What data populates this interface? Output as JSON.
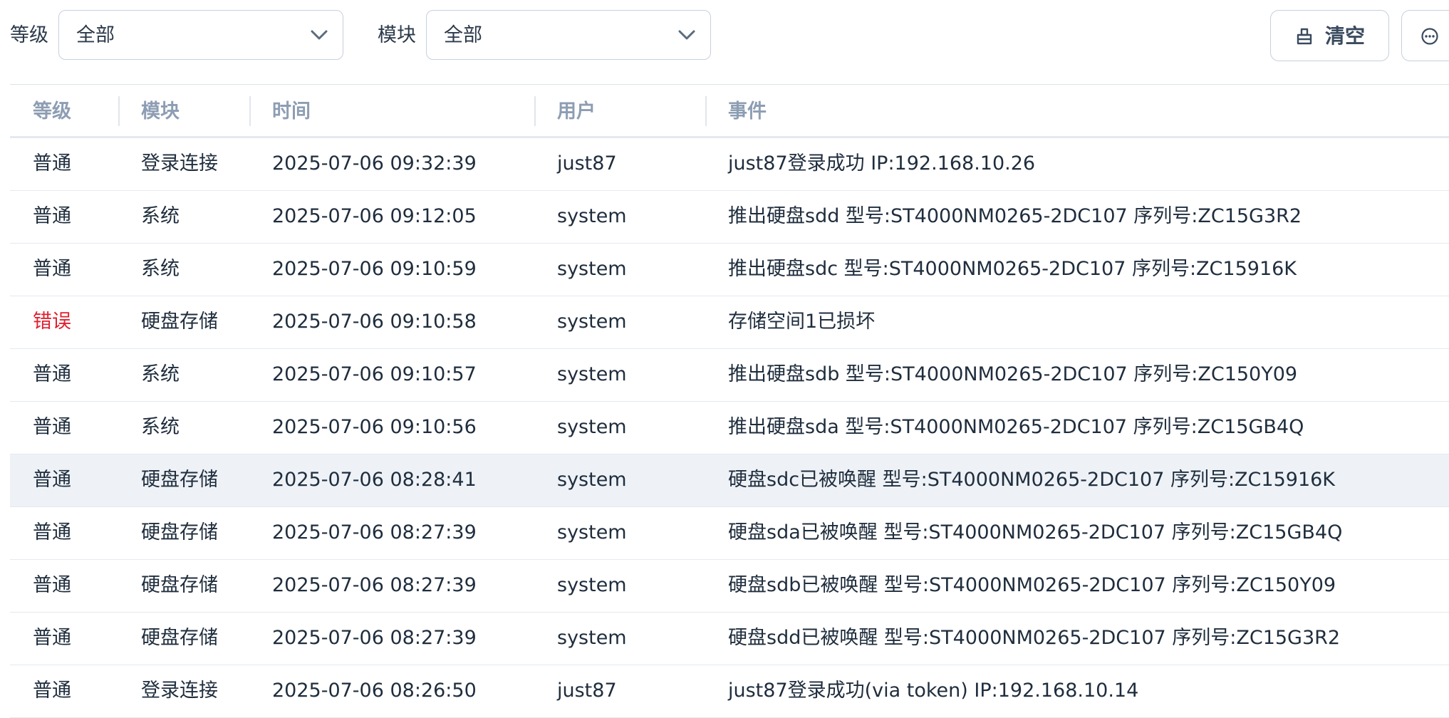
{
  "filters": {
    "level_label": "等级",
    "level_value": "全部",
    "module_label": "模块",
    "module_value": "全部"
  },
  "actions": {
    "clear_label": "清空"
  },
  "table": {
    "headers": [
      "等级",
      "模块",
      "时间",
      "用户",
      "事件"
    ],
    "rows": [
      {
        "level": "普通",
        "module": "登录连接",
        "time": "2025-07-06 09:32:39",
        "user": "just87",
        "event": "just87登录成功 IP:192.168.10.26"
      },
      {
        "level": "普通",
        "module": "系统",
        "time": "2025-07-06 09:12:05",
        "user": "system",
        "event": "推出硬盘sdd 型号:ST4000NM0265-2DC107 序列号:ZC15G3R2"
      },
      {
        "level": "普通",
        "module": "系统",
        "time": "2025-07-06 09:10:59",
        "user": "system",
        "event": "推出硬盘sdc 型号:ST4000NM0265-2DC107 序列号:ZC15916K"
      },
      {
        "level": "错误",
        "module": "硬盘存储",
        "time": "2025-07-06 09:10:58",
        "user": "system",
        "event": "存储空间1已损坏"
      },
      {
        "level": "普通",
        "module": "系统",
        "time": "2025-07-06 09:10:57",
        "user": "system",
        "event": "推出硬盘sdb 型号:ST4000NM0265-2DC107 序列号:ZC150Y09"
      },
      {
        "level": "普通",
        "module": "系统",
        "time": "2025-07-06 09:10:56",
        "user": "system",
        "event": "推出硬盘sda 型号:ST4000NM0265-2DC107 序列号:ZC15GB4Q"
      },
      {
        "level": "普通",
        "module": "硬盘存储",
        "time": "2025-07-06 08:28:41",
        "user": "system",
        "event": "硬盘sdc已被唤醒 型号:ST4000NM0265-2DC107 序列号:ZC15916K"
      },
      {
        "level": "普通",
        "module": "硬盘存储",
        "time": "2025-07-06 08:27:39",
        "user": "system",
        "event": "硬盘sda已被唤醒 型号:ST4000NM0265-2DC107 序列号:ZC15GB4Q"
      },
      {
        "level": "普通",
        "module": "硬盘存储",
        "time": "2025-07-06 08:27:39",
        "user": "system",
        "event": "硬盘sdb已被唤醒 型号:ST4000NM0265-2DC107 序列号:ZC150Y09"
      },
      {
        "level": "普通",
        "module": "硬盘存储",
        "time": "2025-07-06 08:27:39",
        "user": "system",
        "event": "硬盘sdd已被唤醒 型号:ST4000NM0265-2DC107 序列号:ZC15G3R2"
      },
      {
        "level": "普通",
        "module": "登录连接",
        "time": "2025-07-06 08:26:50",
        "user": "just87",
        "event": "just87登录成功(via token) IP:192.168.10.14"
      }
    ]
  },
  "colors": {
    "error": "#e0202f",
    "header_text": "#8d9db3",
    "row_highlight": "#eef2f7"
  },
  "icons": {
    "select_arrow": "chevron-down-icon",
    "clear": "clear-icon",
    "more": "more-icon"
  }
}
